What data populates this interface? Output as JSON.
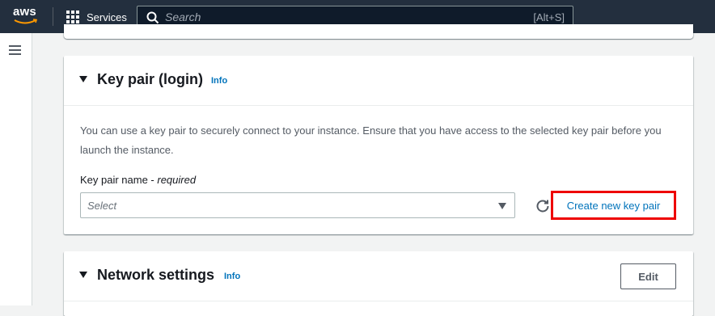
{
  "topbar": {
    "logo_text": "aws",
    "services_label": "Services",
    "search_placeholder": "Search",
    "search_shortcut": "[Alt+S]"
  },
  "keypair_panel": {
    "title": "Key pair (login)",
    "info_label": "Info",
    "description": "You can use a key pair to securely connect to your instance. Ensure that you have access to the selected key pair before you launch the instance.",
    "field_label": "Key pair name - ",
    "field_required": "required",
    "select_value": "Select",
    "create_link": "Create new key pair"
  },
  "network_panel": {
    "title": "Network settings",
    "info_label": "Info",
    "edit_label": "Edit"
  },
  "colors": {
    "nav_bg": "#232f3e",
    "link": "#0073bb",
    "highlight": "#ee0000",
    "logo_smile": "#ff9900"
  },
  "icons": [
    "aws-logo",
    "services-grid-icon",
    "search-icon",
    "hamburger-menu-icon",
    "caret-down-icon",
    "dropdown-caret-icon",
    "refresh-icon"
  ]
}
